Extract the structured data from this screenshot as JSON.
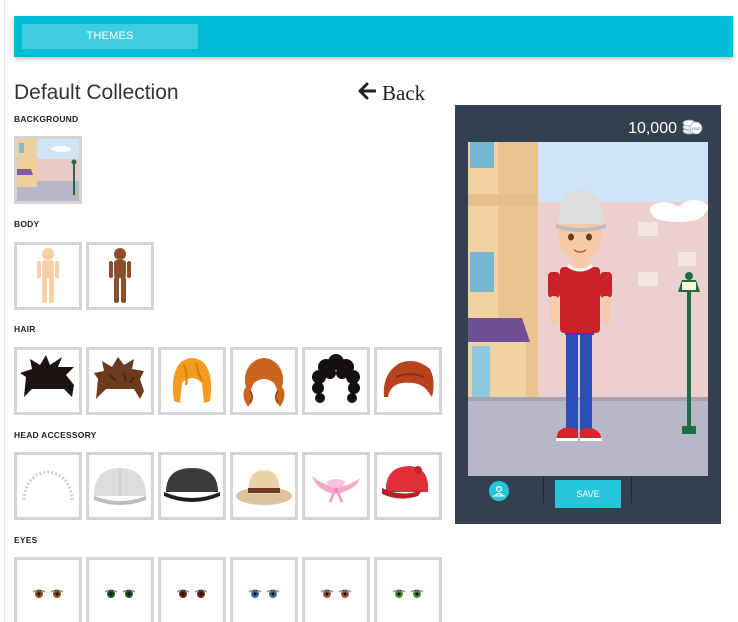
{
  "topbar": {
    "tab_themes": "THEMES"
  },
  "header": {
    "title": "Default Collection",
    "back_label": "Back"
  },
  "sections": {
    "background": "BACKGROUND",
    "body": "BODY",
    "hair": "HAIR",
    "head_accessory": "HEAD ACCESSORY",
    "eyes": "EYES"
  },
  "items": {
    "background": [
      "street-scene"
    ],
    "body": [
      "light-skin",
      "dark-skin"
    ],
    "hair": [
      "spiky-black",
      "brown-messy",
      "orange-bob",
      "auburn-wavy",
      "black-curly",
      "red-swept"
    ],
    "head_accessory": [
      "pearl-headband",
      "white-baseball-cap",
      "black-baseball-cap",
      "tan-fedora",
      "pink-sun-hat",
      "red-cap"
    ],
    "eyes": [
      "brown-eyes",
      "green-eyes",
      "dark-brown-eyes",
      "blue-eyes",
      "hazel-eyes",
      "green-hazel-eyes"
    ]
  },
  "colors": {
    "topbar": "#00bcd4",
    "tab_active": "#3fcde0",
    "preview_bg": "#324050",
    "save_button": "#26c6da",
    "tile_border": "#d4d4d4"
  },
  "preview": {
    "coins": "10,000",
    "coin_icon": "coin-stack-icon",
    "save_label": "SAVE",
    "avatar_icon": "avatar-pin-icon"
  }
}
